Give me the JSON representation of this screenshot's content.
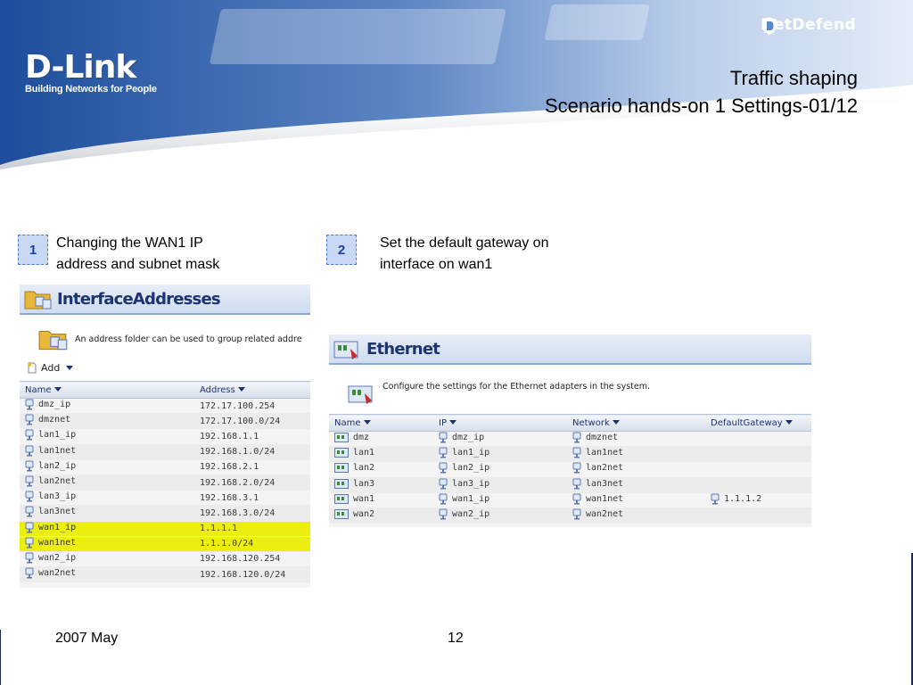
{
  "header": {
    "brand": "D-Link",
    "tagline": "Building Networks for People",
    "product": "NetDefend",
    "title_line1": "Traffic shaping",
    "title_line2": "Scenario hands-on 1 Settings-01/12"
  },
  "steps": [
    {
      "number": "1",
      "text_line1": "Changing the WAN1 IP",
      "text_line2": "address and subnet mask"
    },
    {
      "number": "2",
      "text_line1": "Set the default gateway on",
      "text_line2": "interface on wan1"
    }
  ],
  "interface_addresses": {
    "title": "InterfaceAddresses",
    "description": "An address folder can be used to group related addre",
    "add_label": "Add",
    "columns": [
      "Name",
      "Address"
    ],
    "rows": [
      {
        "name": "dmz_ip",
        "address": "172.17.100.254",
        "highlight": false
      },
      {
        "name": "dmznet",
        "address": "172.17.100.0/24",
        "highlight": false
      },
      {
        "name": "lan1_ip",
        "address": "192.168.1.1",
        "highlight": false
      },
      {
        "name": "lan1net",
        "address": "192.168.1.0/24",
        "highlight": false
      },
      {
        "name": "lan2_ip",
        "address": "192.168.2.1",
        "highlight": false
      },
      {
        "name": "lan2net",
        "address": "192.168.2.0/24",
        "highlight": false
      },
      {
        "name": "lan3_ip",
        "address": "192.168.3.1",
        "highlight": false
      },
      {
        "name": "lan3net",
        "address": "192.168.3.0/24",
        "highlight": false
      },
      {
        "name": "wan1_ip",
        "address": "1.1.1.1",
        "highlight": true
      },
      {
        "name": "wan1net",
        "address": "1.1.1.0/24",
        "highlight": true
      },
      {
        "name": "wan2_ip",
        "address": "192.168.120.254",
        "highlight": false
      },
      {
        "name": "wan2net",
        "address": "192.168.120.0/24",
        "highlight": false
      }
    ]
  },
  "ethernet": {
    "title": "Ethernet",
    "description": "Configure the settings for the Ethernet adapters in the system.",
    "columns": [
      "Name",
      "IP",
      "Network",
      "DefaultGateway"
    ],
    "rows": [
      {
        "name": "dmz",
        "ip": "dmz_ip",
        "network": "dmznet",
        "gateway": ""
      },
      {
        "name": "lan1",
        "ip": "lan1_ip",
        "network": "lan1net",
        "gateway": ""
      },
      {
        "name": "lan2",
        "ip": "lan2_ip",
        "network": "lan2net",
        "gateway": ""
      },
      {
        "name": "lan3",
        "ip": "lan3_ip",
        "network": "lan3net",
        "gateway": ""
      },
      {
        "name": "wan1",
        "ip": "wan1_ip",
        "network": "wan1net",
        "gateway": "1.1.1.2"
      },
      {
        "name": "wan2",
        "ip": "wan2_ip",
        "network": "wan2net",
        "gateway": ""
      }
    ]
  },
  "footer": {
    "date": "2007 May",
    "page": "12"
  },
  "colors": {
    "banner_blue": "#1f4f9c",
    "highlight": "#ecee10",
    "title_navy": "#1c3470"
  }
}
